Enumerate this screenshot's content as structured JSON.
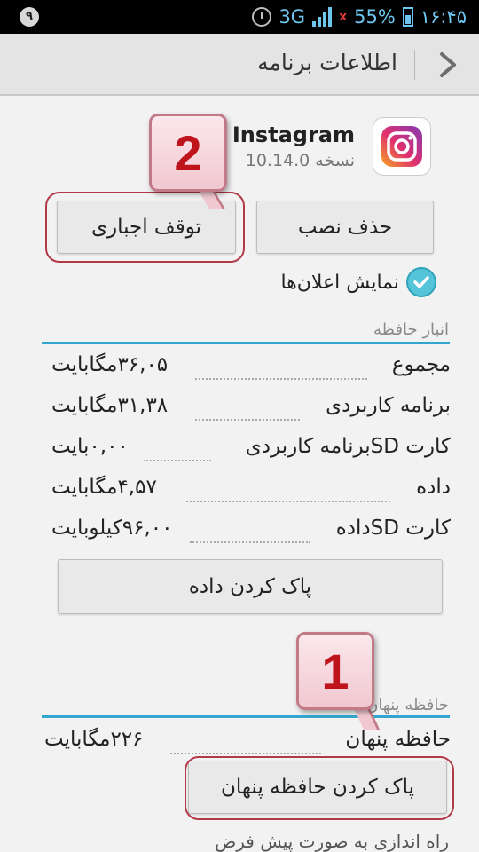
{
  "status_bar": {
    "notification_count": "۹",
    "network": "3G",
    "battery": "55%",
    "time": "۱۶:۴۵"
  },
  "header": {
    "title": "اطلاعات برنامه"
  },
  "app": {
    "name": "Instagram",
    "version": "نسخه 10.14.0"
  },
  "buttons": {
    "uninstall": "حذف نصب",
    "force_stop": "توقف اجباری",
    "clear_data": "پاک کردن داده",
    "clear_cache": "پاک کردن حافظه پنهان"
  },
  "notifications": {
    "label": "نمایش اعلان‌ها",
    "checked": true
  },
  "storage": {
    "title": "انبار حافظه",
    "rows": [
      {
        "label": "مجموع",
        "value": "۳۶,۰۵مگابایت"
      },
      {
        "label": "برنامه کاربردی",
        "value": "۳۱,۳۸مگابایت"
      },
      {
        "label": "کارت SDبرنامه کاربردی",
        "value": "۰,۰۰بایت"
      },
      {
        "label": "داده",
        "value": "۴,۵۷مگابایت"
      },
      {
        "label": "کارت SDداده",
        "value": "۹۶,۰۰کیلوبایت"
      }
    ]
  },
  "cache": {
    "title": "حافظه پنهان",
    "label": "حافظه پنهان",
    "value": "۲۲۶مگابایت"
  },
  "callouts": {
    "first": "1",
    "second": "2"
  },
  "defaults": {
    "title": "راه اندازی به صورت پیش فرض"
  },
  "colors": {
    "accent": "#33a6cf",
    "callout_red": "#c0141c",
    "status_blue": "#6ec6f0"
  }
}
